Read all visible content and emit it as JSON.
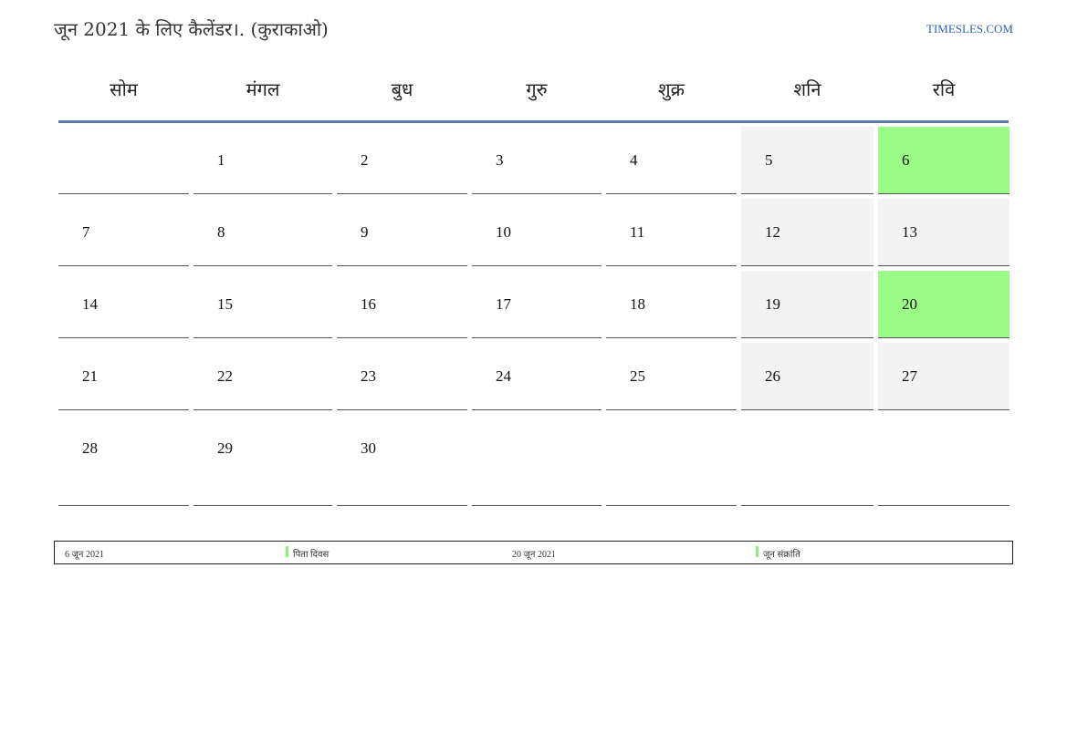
{
  "header": {
    "title": "जून 2021 के लिए कैलेंडर।. (कुराकाओ)",
    "site": "TIMESLES.COM"
  },
  "colors": {
    "holiday": "#9cfc88",
    "weekend": "#f3f3f3",
    "header_rule": "#5b7bab",
    "link": "#2a64b0"
  },
  "weekdays": [
    "सोम",
    "मंगल",
    "बुध",
    "गुरु",
    "शुक्र",
    "शनि",
    "रवि"
  ],
  "weeks": [
    [
      "",
      "1",
      "2",
      "3",
      "4",
      "5",
      "6"
    ],
    [
      "7",
      "8",
      "9",
      "10",
      "11",
      "12",
      "13"
    ],
    [
      "14",
      "15",
      "16",
      "17",
      "18",
      "19",
      "20"
    ],
    [
      "21",
      "22",
      "23",
      "24",
      "25",
      "26",
      "27"
    ],
    [
      "28",
      "29",
      "30",
      "",
      "",
      "",
      ""
    ]
  ],
  "holidays": [
    "6",
    "20"
  ],
  "legend": [
    {
      "date": "6 जून 2021",
      "name": "पिता दिवस"
    },
    {
      "date": "20 जून 2021",
      "name": "जून संक्रांति"
    }
  ]
}
